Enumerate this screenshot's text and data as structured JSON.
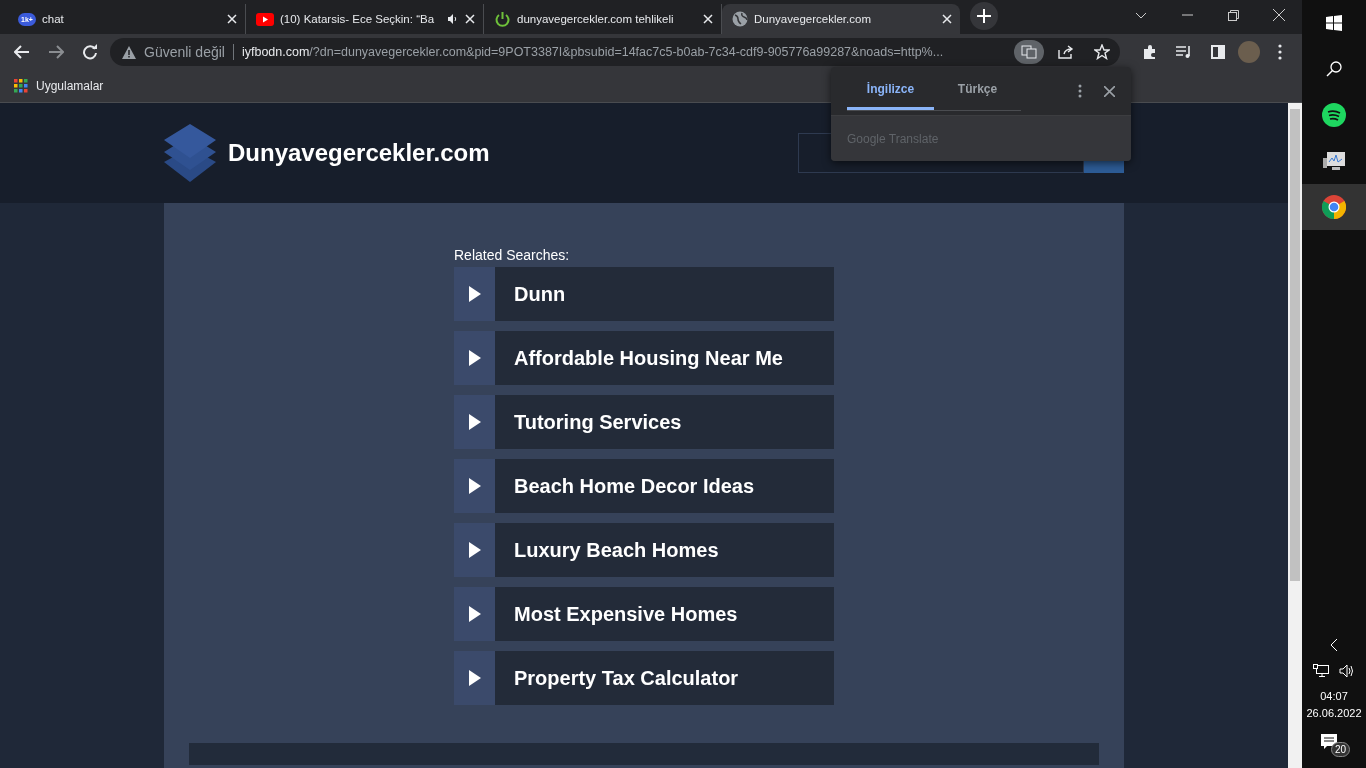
{
  "tabs": [
    {
      "title": "chat",
      "kind": "badge",
      "badge": "1k+",
      "selected": false,
      "audio": false
    },
    {
      "title": "(10) Katarsis- Ece Seçkin: “Ba",
      "kind": "video",
      "selected": false,
      "audio": true
    },
    {
      "title": "dunyavegercekler.com tehlikeli",
      "kind": "power",
      "selected": false,
      "audio": false
    },
    {
      "title": "Dunyavegercekler.com",
      "kind": "globe",
      "selected": true,
      "audio": false
    }
  ],
  "address_bar": {
    "security": "Güvenli değil",
    "host": "iyfbodn.com",
    "path": "/?dn=dunyavegercekler.com&pid=9POT3387I&pbsubid=14fac7c5-b0ab-7c34-cdf9-905776a99287&noads=http%..."
  },
  "bookmarks": [
    "Uygulamalar"
  ],
  "translate_popup": {
    "tabs": [
      {
        "label": "İngilizce",
        "selected": true
      },
      {
        "label": "Türkçe",
        "selected": false
      }
    ],
    "footer": "Google Translate"
  },
  "site": {
    "logo": "Dunyavegercekler.com",
    "related_label": "Related Searches:",
    "related": [
      "Dunn",
      "Affordable Housing Near Me",
      "Tutoring Services",
      "Beach Home Decor Ideas",
      "Luxury Beach Homes",
      "Most Expensive Homes",
      "Property Tax Calculator"
    ]
  },
  "taskbar": {
    "apps": [
      {
        "kind": "spotify",
        "selected": false
      },
      {
        "kind": "monitor",
        "selected": false
      },
      {
        "kind": "chrome",
        "selected": true
      }
    ],
    "time": "04:07",
    "date": "26.06.2022",
    "notifications": "20"
  }
}
